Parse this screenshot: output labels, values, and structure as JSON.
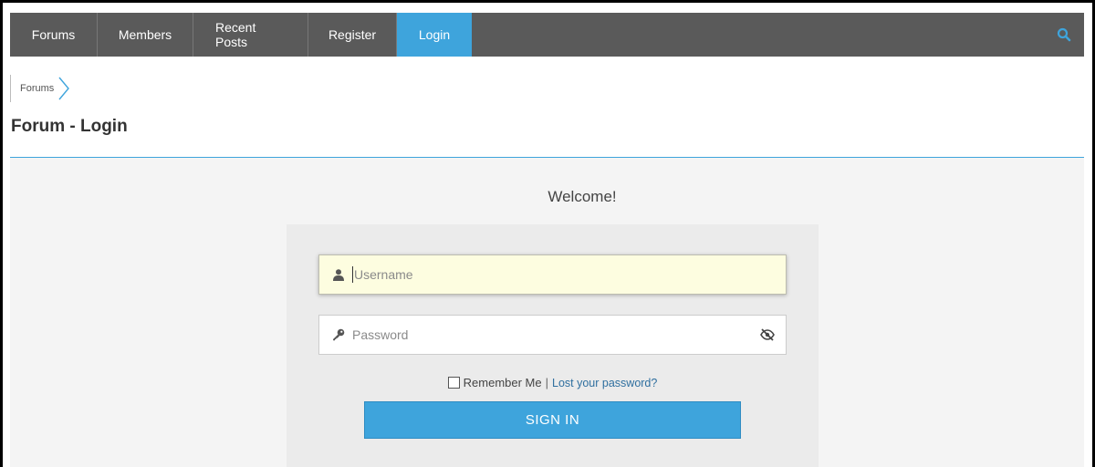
{
  "nav": {
    "items": [
      {
        "label": "Forums"
      },
      {
        "label": "Members"
      },
      {
        "label": "Recent Posts"
      },
      {
        "label": "Register"
      },
      {
        "label": "Login"
      }
    ],
    "active_index": 4,
    "search_icon": "search-icon"
  },
  "breadcrumb": {
    "items": [
      {
        "label": "Forums"
      }
    ],
    "separator_icon": "chevron-right-icon"
  },
  "page": {
    "title": "Forum - Login"
  },
  "login": {
    "welcome": "Welcome!",
    "username": {
      "placeholder": "Username",
      "value": "",
      "icon": "user-icon"
    },
    "password": {
      "placeholder": "Password",
      "value": "",
      "icon": "key-icon",
      "toggle_icon": "eye-slash-icon"
    },
    "remember_label": "Remember Me",
    "separator": "|",
    "lost_password": "Lost your password?",
    "sign_in": "SIGN IN"
  },
  "colors": {
    "nav_bg": "#5a5a5a",
    "accent": "#3ea4dc",
    "content_bg": "#f4f4f4",
    "panel_bg": "#ebebeb",
    "username_focus_bg": "#fdfde0"
  }
}
